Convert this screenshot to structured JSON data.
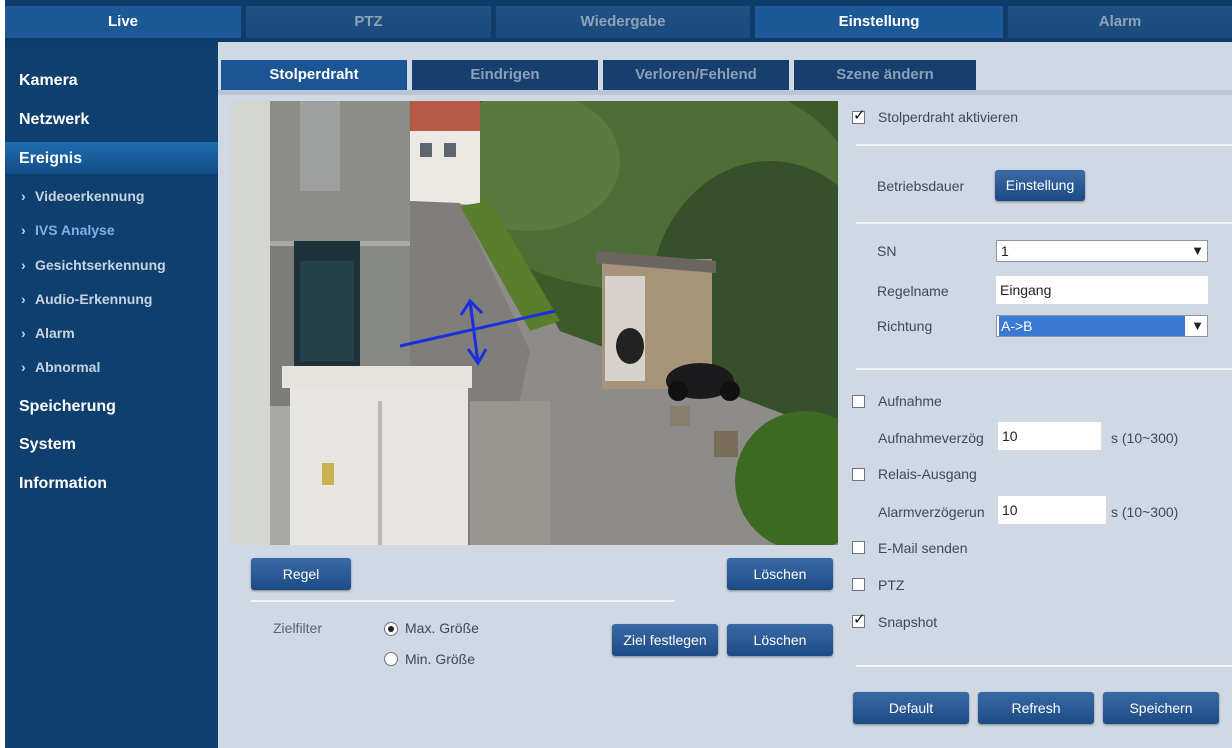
{
  "topnav": {
    "items": [
      {
        "label": "Live"
      },
      {
        "label": "PTZ"
      },
      {
        "label": "Wiedergabe"
      },
      {
        "label": "Einstellung"
      },
      {
        "label": "Alarm"
      }
    ]
  },
  "sidebar": {
    "main": [
      "Kamera",
      "Netzwerk",
      "Ereignis",
      "Speicherung",
      "System",
      "Information"
    ],
    "sub": [
      "Videoerkennung",
      "IVS Analyse",
      "Gesichtserkennung",
      "Audio-Erkennung",
      "Alarm",
      "Abnormal"
    ]
  },
  "tabs": [
    "Stolperdraht",
    "Eindrigen",
    "Verloren/Fehlend",
    "Szene ändern"
  ],
  "video": {
    "regel_label": "Regel",
    "loeschen_label": "Löschen"
  },
  "filter": {
    "label": "Zielfilter",
    "max_label": "Max. Größe",
    "min_label": "Min. Größe",
    "ziel_label": "Ziel festlegen",
    "loeschen_label": "Löschen"
  },
  "settings": {
    "enable_label": "Stolperdraht aktivieren",
    "betriebsdauer_label": "Betriebsdauer",
    "einstellung_label": "Einstellung",
    "sn_label": "SN",
    "sn_value": "1",
    "regelname_label": "Regelname",
    "regelname_value": "Eingang",
    "richtung_label": "Richtung",
    "richtung_value": "A->B",
    "aufnahme_label": "Aufnahme",
    "aufnahmeverz_label": "Aufnahmeverzög",
    "aufnahmeverz_value": "10",
    "aufnahmeverz_unit": "s (10~300)",
    "relais_label": "Relais-Ausgang",
    "alarmverz_label": "Alarmverzögerun",
    "alarmverz_value": "10",
    "alarmverz_unit": "s (10~300)",
    "email_label": "E-Mail senden",
    "ptz_label": "PTZ",
    "snapshot_label": "Snapshot",
    "default_label": "Default",
    "refresh_label": "Refresh",
    "speichern_label": "Speichern"
  },
  "colors": {
    "nav_dark": "#0f3c6b",
    "nav_active": "#1c5996",
    "content_bg": "#cfd8e3",
    "tripwire": "#1a2fe0"
  }
}
